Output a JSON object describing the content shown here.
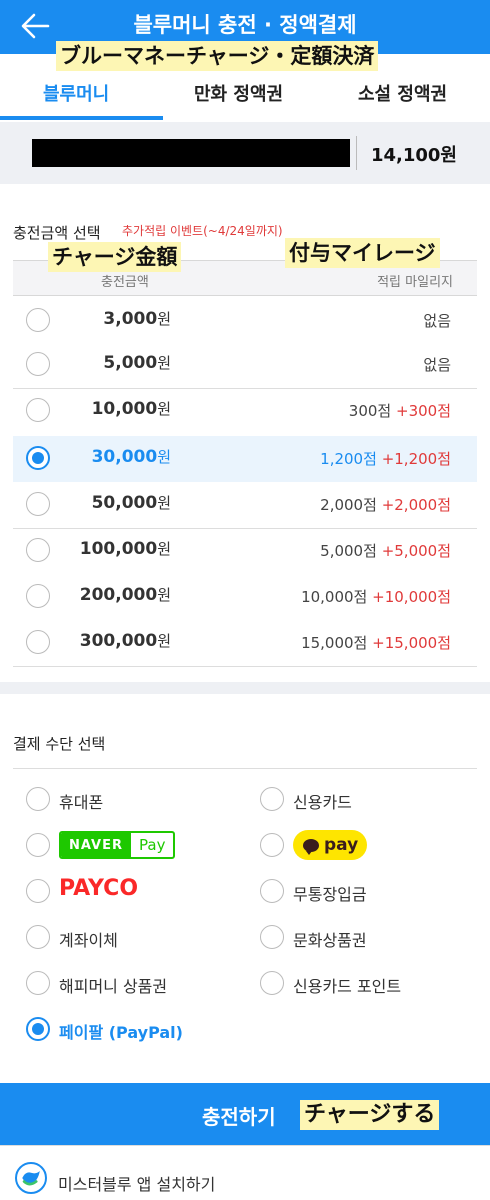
{
  "header": {
    "title": "블루머니 충전 · 정액결제",
    "translation_label": "ブルーマネーチャージ・定額決済"
  },
  "tabs": [
    {
      "label": "블루머니",
      "active": true
    },
    {
      "label": "만화 정액권",
      "active": false
    },
    {
      "label": "소설 정액권",
      "active": false
    }
  ],
  "balance": {
    "amount": "14,100원"
  },
  "charge": {
    "section_label": "충전금액 선택",
    "event_note": "추가적립 이벤트(~4/24일까지)",
    "translation_amount_label": "チャージ金額",
    "translation_mileage_label": "付与マイレージ",
    "col_amount": "충전금액",
    "col_mileage": "적립 마일리지",
    "options": [
      {
        "amount": "3,000",
        "won": "원",
        "points": "없음",
        "bonus": "",
        "selected": false
      },
      {
        "amount": "5,000",
        "won": "원",
        "points": "없음",
        "bonus": "",
        "selected": false
      },
      {
        "amount": "10,000",
        "won": "원",
        "points": "300점",
        "bonus": "+300점",
        "selected": false
      },
      {
        "amount": "30,000",
        "won": "원",
        "points": "1,200점",
        "bonus": "+1,200점",
        "selected": true
      },
      {
        "amount": "50,000",
        "won": "원",
        "points": "2,000점",
        "bonus": "+2,000점",
        "selected": false
      },
      {
        "amount": "100,000",
        "won": "원",
        "points": "5,000점",
        "bonus": "+5,000점",
        "selected": false
      },
      {
        "amount": "200,000",
        "won": "원",
        "points": "10,000점",
        "bonus": "+10,000점",
        "selected": false
      },
      {
        "amount": "300,000",
        "won": "원",
        "points": "15,000점",
        "bonus": "+15,000점",
        "selected": false
      }
    ]
  },
  "payment": {
    "section_label": "결제 수단 선택",
    "methods": {
      "phone": "휴대폰",
      "credit_card": "신용카드",
      "naver_pay_brand": "NAVER",
      "naver_pay_suffix": "Pay",
      "kakao_pay": "pay",
      "payco": "PAYCO",
      "bank_deposit": "무통장입금",
      "account_transfer": "계좌이체",
      "culture_voucher": "문화상품권",
      "happy_money": "해피머니 상품권",
      "card_points": "신용카드 포인트",
      "paypal": "페이팔 (PayPal)"
    },
    "selected": "paypal"
  },
  "cta": {
    "label": "충전하기",
    "translation_label": "チャージする"
  },
  "footer": {
    "app_install": "미스터블루 앱 설치하기"
  },
  "colors": {
    "brand": "#1a8cf0",
    "bonus": "#e03a3a",
    "highlight": "#fdf6b4"
  }
}
